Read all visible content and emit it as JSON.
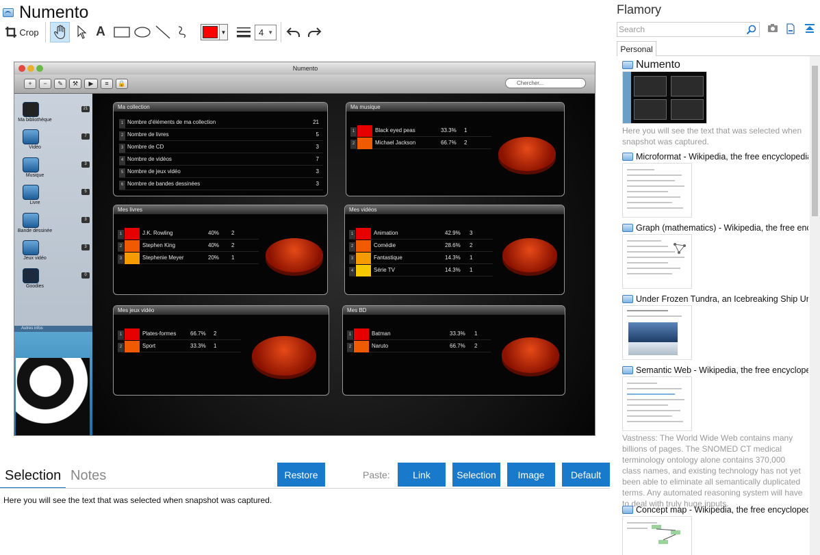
{
  "app": {
    "title": "Numento"
  },
  "toolbar": {
    "crop_label": "Crop",
    "line_width": "4"
  },
  "screenshot": {
    "window_title": "Numento",
    "search_placeholder": "Chercher...",
    "sidebar": {
      "items": [
        {
          "label": "Ma bibliothèque",
          "count": "21"
        },
        {
          "label": "Vidéo",
          "count": "7"
        },
        {
          "label": "Musique",
          "count": "3"
        },
        {
          "label": "Livre",
          "count": "5"
        },
        {
          "label": "Bande dessinée",
          "count": "3"
        },
        {
          "label": "Jeux vidéo",
          "count": "3"
        },
        {
          "label": "Goodies",
          "count": "0"
        }
      ],
      "more": "Autres infos"
    },
    "panels": {
      "collection": {
        "title": "Ma collection",
        "rows": [
          {
            "idx": "1",
            "label": "Nombre d'éléments de ma collection",
            "value": "21"
          },
          {
            "idx": "2",
            "label": "Nombre de livres",
            "value": "5"
          },
          {
            "idx": "3",
            "label": "Nombre de CD",
            "value": "3"
          },
          {
            "idx": "4",
            "label": "Nombre de vidéos",
            "value": "7"
          },
          {
            "idx": "5",
            "label": "Nombre de jeux vidéo",
            "value": "3"
          },
          {
            "idx": "6",
            "label": "Nombre de bandes dessinées",
            "value": "3"
          }
        ]
      },
      "musique": {
        "title": "Ma musique",
        "rows": [
          {
            "idx": "1",
            "label": "Black eyed peas",
            "pct": "33.3%",
            "n": "1",
            "color": "#e60000"
          },
          {
            "idx": "2",
            "label": "Michael Jackson",
            "pct": "66.7%",
            "n": "2",
            "color": "#f05a00"
          }
        ]
      },
      "livres": {
        "title": "Mes livres",
        "rows": [
          {
            "idx": "1",
            "label": "J.K. Rowling",
            "pct": "40%",
            "n": "2",
            "color": "#e60000"
          },
          {
            "idx": "2",
            "label": "Stephen King",
            "pct": "40%",
            "n": "2",
            "color": "#f05a00"
          },
          {
            "idx": "3",
            "label": "Stephenie Meyer",
            "pct": "20%",
            "n": "1",
            "color": "#f59a00"
          }
        ]
      },
      "videos": {
        "title": "Mes vidéos",
        "rows": [
          {
            "idx": "1",
            "label": "Animation",
            "pct": "42.9%",
            "n": "3",
            "color": "#e60000"
          },
          {
            "idx": "2",
            "label": "Comédie",
            "pct": "28.6%",
            "n": "2",
            "color": "#f05a00"
          },
          {
            "idx": "3",
            "label": "Fantastique",
            "pct": "14.3%",
            "n": "1",
            "color": "#f59a00"
          },
          {
            "idx": "4",
            "label": "Série TV",
            "pct": "14.3%",
            "n": "1",
            "color": "#f5c800"
          }
        ]
      },
      "jeux": {
        "title": "Mes jeux vidéo",
        "rows": [
          {
            "idx": "1",
            "label": "Plates-formes",
            "pct": "66.7%",
            "n": "2",
            "color": "#e60000"
          },
          {
            "idx": "2",
            "label": "Sport",
            "pct": "33.3%",
            "n": "1",
            "color": "#f05a00"
          }
        ]
      },
      "bd": {
        "title": "Mes BD",
        "rows": [
          {
            "idx": "1",
            "label": "Batman",
            "pct": "33.3%",
            "n": "1",
            "color": "#e60000"
          },
          {
            "idx": "2",
            "label": "Naruto",
            "pct": "66.7%",
            "n": "2",
            "color": "#f05a00"
          }
        ]
      }
    }
  },
  "bottom": {
    "tab_selection": "Selection",
    "tab_notes": "Notes",
    "restore": "Restore",
    "paste_label": "Paste:",
    "link": "Link",
    "selection": "Selection",
    "image": "Image",
    "default": "Default",
    "selection_text": "Here you will see the text that was selected when snapshot was captured."
  },
  "right": {
    "title": "Flamory",
    "search_placeholder": "Search",
    "tab_personal": "Personal",
    "items": [
      {
        "title": "Numento",
        "desc": "Here you will see the text that was selected when snapshot was captured."
      },
      {
        "title": "Microformat - Wikipedia, the free encyclopedia",
        "desc": ""
      },
      {
        "title": "Graph (mathematics) - Wikipedia, the free ency",
        "desc": ""
      },
      {
        "title": "Under Frozen Tundra, an Icebreaking Ship Unco",
        "desc": ""
      },
      {
        "title": "Semantic Web - Wikipedia, the free encycloped",
        "desc": "Vastness: The World Wide Web contains many billions of pages. The SNOMED CT medical terminology ontology alone contains 370,000 class names, and existing technology has not yet been able to eliminate all semantically duplicated terms. Any automated reasoning system will have to deal with truly huge inputs."
      },
      {
        "title": "Concept map - Wikipedia, the free encyclopedi",
        "desc": ""
      }
    ]
  }
}
